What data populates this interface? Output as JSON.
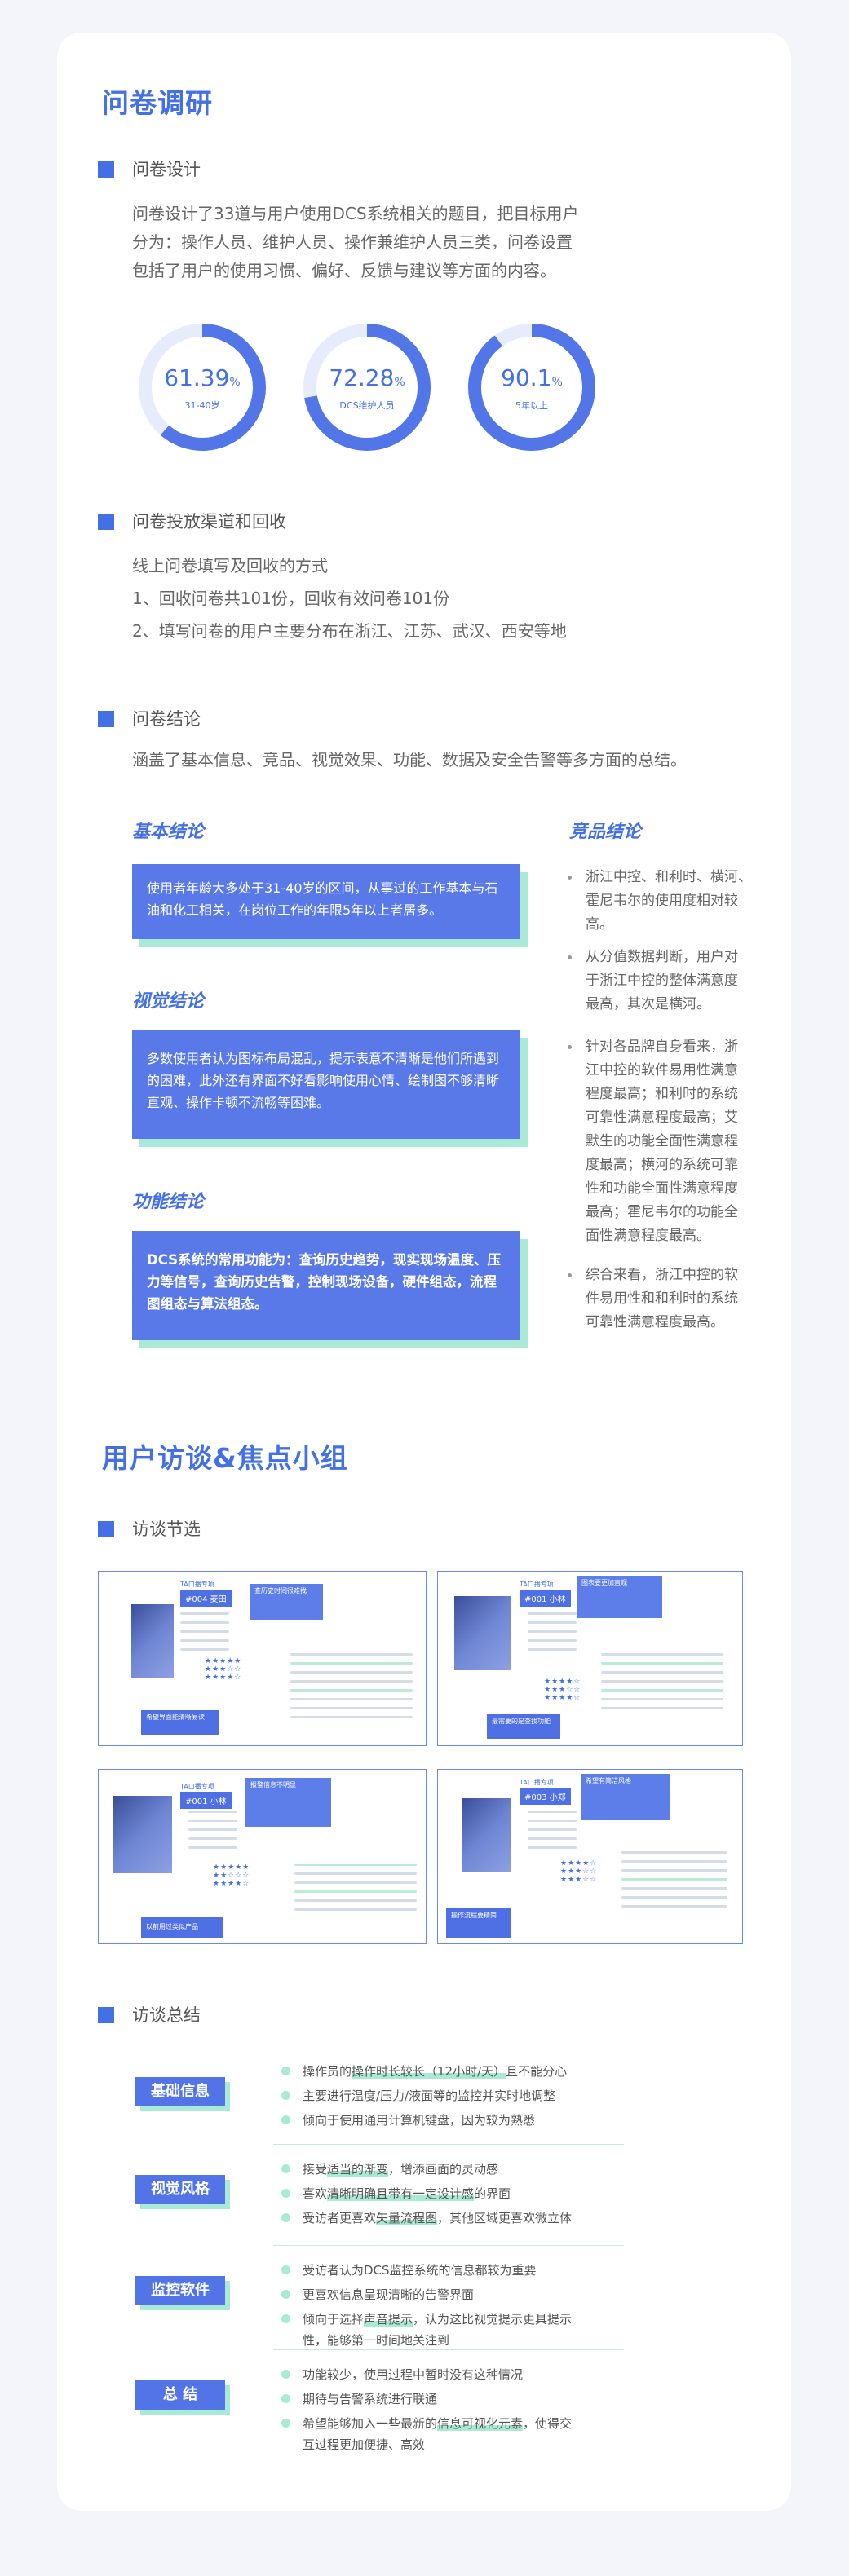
{
  "survey": {
    "title": "问卷调研",
    "design": {
      "heading": "问卷设计",
      "lines": [
        "问卷设计了33道与用户使用DCS系统相关的题目，把目标用户",
        "分为：操作人员、维护人员、操作兼维护人员三类，问卷设置",
        "包括了用户的使用习惯、偏好、反馈与建议等方面的内容。"
      ],
      "rings": [
        {
          "value": "61.39",
          "unit": "%",
          "label": "31-40岁",
          "pct": 61.39
        },
        {
          "value": "72.28",
          "unit": "%",
          "label": "DCS维护人员",
          "pct": 72.28
        },
        {
          "value": "90.1",
          "unit": "%",
          "label": "5年以上",
          "pct": 90.1
        }
      ]
    },
    "channel": {
      "heading": "问卷投放渠道和回收",
      "lines": [
        "线上问卷填写及回收的方式",
        "1、回收问卷共101份，回收有效问卷101份",
        "2、填写问卷的用户主要分布在浙江、江苏、武汉、西安等地"
      ]
    },
    "conclusion": {
      "heading": "问卷结论",
      "intro": "涵盖了基本信息、竞品、视觉效果、功能、数据及安全告警等多方面的总结。",
      "basic_title": "基本结论",
      "basic_text": "使用者年龄大多处于31-40岁的区间，从事过的工作基本与石油和化工相关，在岗位工作的年限5年以上者居多。",
      "visual_title": "视觉结论",
      "visual_text": "多数使用者认为图标布局混乱，提示表意不清晰是他们所遇到的困难，此外还有界面不好看影响使用心情、绘制图不够清晰直观、操作卡顿不流畅等困难。",
      "function_title": "功能结论",
      "function_text": "DCS系统的常用功能为：查询历史趋势，现实现场温度、压力等信号，查询历史告警，控制现场设备，硬件组态，流程图组态与算法组态。",
      "competitor_title": "竞品结论",
      "competitor_items": [
        [
          "浙江中控、和利时、横河、",
          "霍尼韦尔的使用度相对较",
          "高。"
        ],
        [
          "从分值数据判断，用户对",
          "于浙江中控的整体满意度",
          "最高，其次是横河。"
        ],
        [
          " 针对各品牌自身看来，浙",
          "江中控的软件易用性满意",
          "程度最高；和利时的系统",
          "可靠性满意程度最高；艾",
          "默生的功能全面性满意程",
          "度最高；横河的系统可靠",
          "性和功能全面性满意程度",
          "最高；霍尼韦尔的功能全",
          "面性满意程度最高。"
        ],
        [
          "综合来看，浙江中控的软",
          "件易用性和和利时的系统",
          "可靠性满意程度最高。"
        ]
      ]
    }
  },
  "interview": {
    "title": "用户访谈&焦点小组",
    "excerpt_heading": "访谈节选",
    "cards": [
      {
        "tag": "TA口播专项",
        "id": "#004 麦田",
        "quote": "查历史时间很难找",
        "footer": "希望界面能清晰易读"
      },
      {
        "tag": "TA口播专项",
        "id": "#001 小林",
        "quote": "图表要更加直观",
        "footer": "最需要的是查找功能"
      },
      {
        "tag": "TA口播专项",
        "id": "#001 小林",
        "quote": "报警信息不明显",
        "footer": "以前用过类似产品"
      },
      {
        "tag": "TA口播专项",
        "id": "#003 小郑",
        "quote": "希望有简洁风格",
        "footer": "操作流程要精简"
      }
    ],
    "summary_heading": "访谈总结",
    "groups": [
      {
        "label": "基础信息",
        "items": [
          {
            "pre": "操作员的",
            "hl": "操作时长较长（12小时/天）",
            "post": "且不能分心"
          },
          {
            "pre": "主要进行温度/压力/液面等的监控并实时地调整",
            "hl": "",
            "post": ""
          },
          {
            "pre": "倾向于使用通用计算机键盘，因为较为熟悉",
            "hl": "",
            "post": ""
          }
        ]
      },
      {
        "label": "视觉风格",
        "items": [
          {
            "pre": "接受",
            "hl": "适当的渐变",
            "post": "，增添画面的灵动感"
          },
          {
            "pre": "喜欢",
            "hl": "清晰明确且带有一定设计感",
            "post": "的界面"
          },
          {
            "pre": "受访者更喜欢",
            "hl": "矢量流程图",
            "post": "，其他区域更喜欢微立体"
          }
        ]
      },
      {
        "label": "监控软件",
        "items": [
          {
            "pre": "受访者认为DCS监控系统的信息都较为重要",
            "hl": "",
            "post": ""
          },
          {
            "pre": "更喜欢信息呈现清晰的告警界面",
            "hl": "",
            "post": ""
          },
          {
            "pre": "倾向于选择",
            "hl": "声音提示",
            "post": "，认为这比视觉提示更具提示",
            "post2": "性，能够第一时间地关注到"
          }
        ]
      },
      {
        "label": "总  结",
        "items": [
          {
            "pre": "功能较少，使用过程中暂时没有这种情况",
            "hl": "",
            "post": ""
          },
          {
            "pre": "期待与告警系统进行联通",
            "hl": "",
            "post": ""
          },
          {
            "pre": "希望能够加入一些最新的",
            "hl": "信息可视化元素",
            "post": "，使得交",
            "post2": "互过程更加便捷、高效"
          }
        ]
      }
    ]
  },
  "colors": {
    "accent": "#4470e6",
    "box": "#5a79e8",
    "mint": "#a8ead6"
  }
}
